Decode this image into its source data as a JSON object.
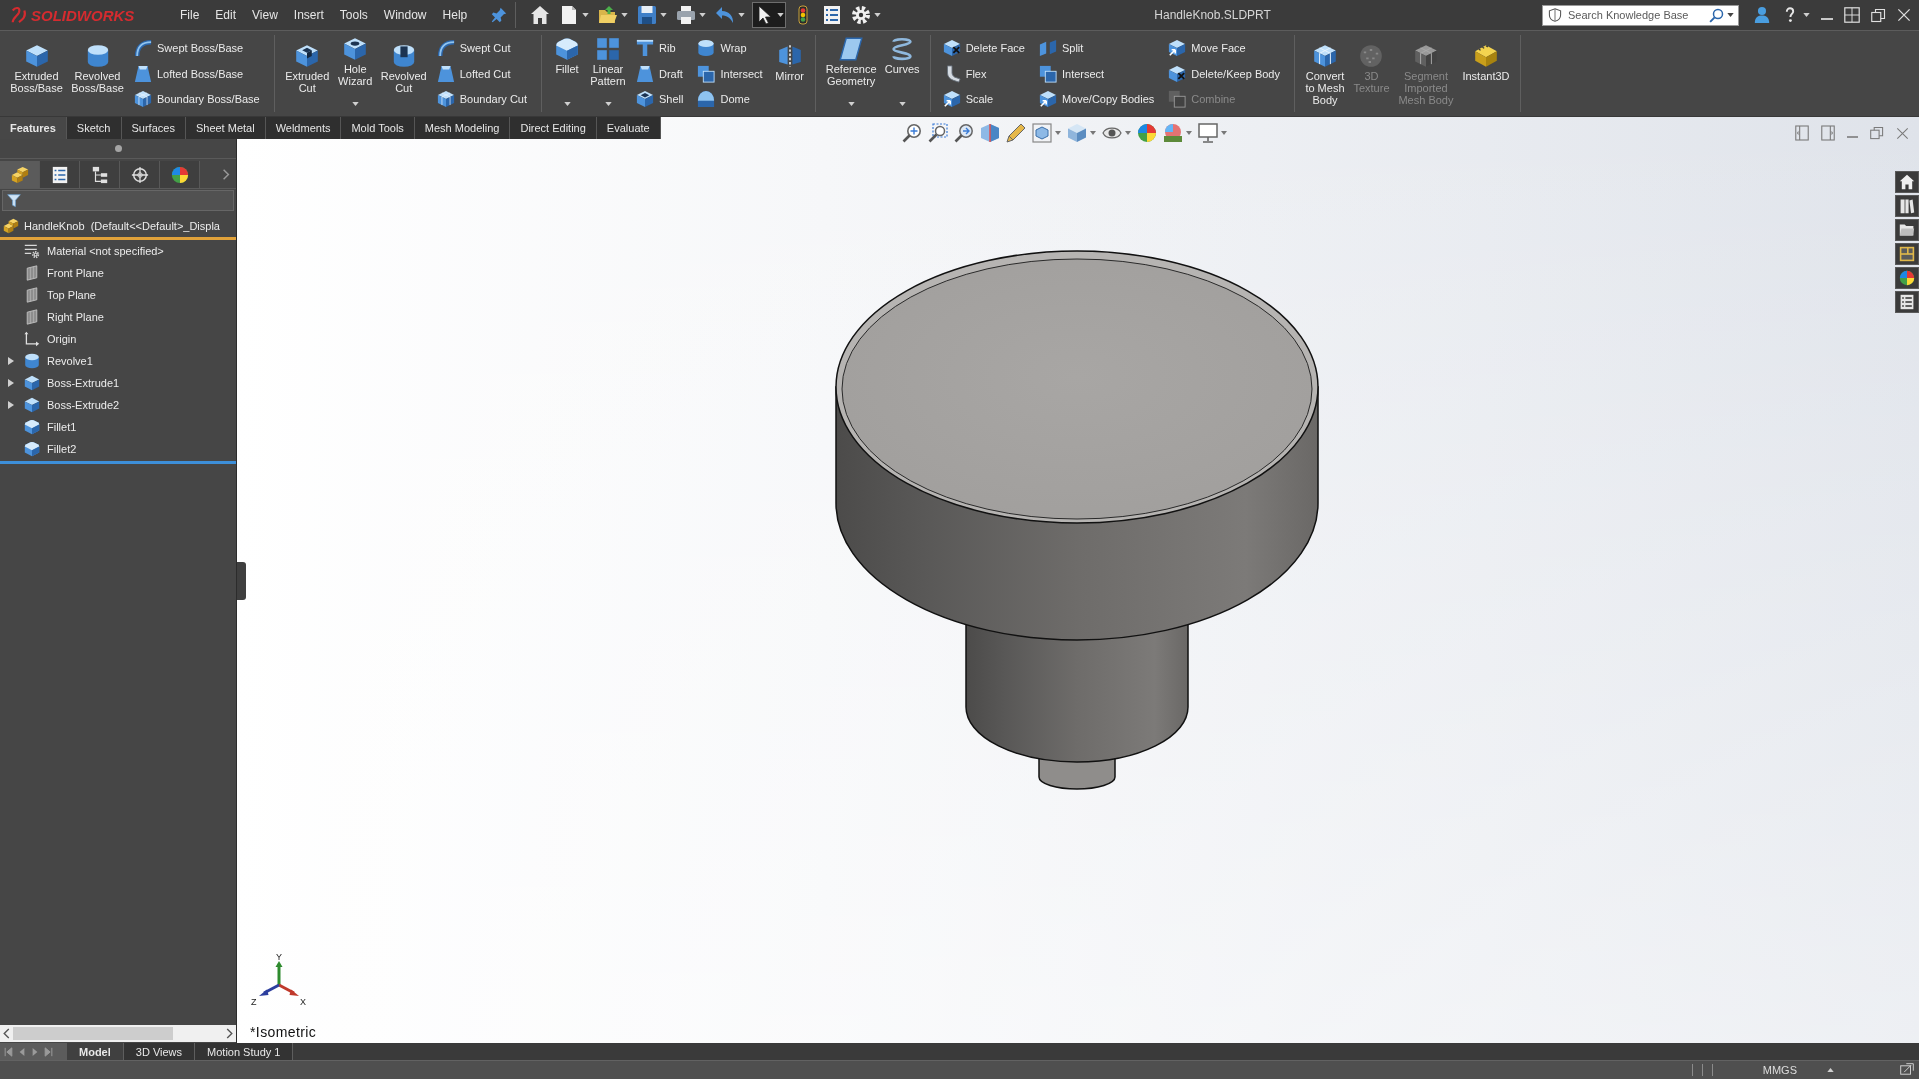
{
  "title_bar": {
    "logo": "SOLIDWORKS",
    "menu": [
      "File",
      "Edit",
      "View",
      "Insert",
      "Tools",
      "Window",
      "Help"
    ],
    "quick_access": [
      {
        "kind": "home",
        "dropdown": false,
        "selected": false
      },
      {
        "kind": "new",
        "dropdown": true,
        "selected": false
      },
      {
        "kind": "open",
        "dropdown": true,
        "selected": false
      },
      {
        "kind": "save",
        "dropdown": true,
        "selected": false
      },
      {
        "kind": "print",
        "dropdown": true,
        "selected": false
      },
      {
        "kind": "undo",
        "dropdown": true,
        "selected": false
      },
      {
        "kind": "select",
        "dropdown": true,
        "selected": true
      },
      {
        "kind": "rebuild",
        "dropdown": false,
        "selected": false
      },
      {
        "kind": "properties",
        "dropdown": false,
        "selected": false
      },
      {
        "kind": "options",
        "dropdown": true,
        "selected": false
      }
    ],
    "document_title": "HandleKnob.SLDPRT",
    "search": {
      "placeholder": "Search Knowledge Base"
    }
  },
  "ribbon": {
    "groups": [
      {
        "items": [
          {
            "kind": "extrude",
            "label": "Extruded Boss/Base",
            "dropdown": false,
            "disabled": false
          },
          {
            "kind": "revolve",
            "label": "Revolved Boss/Base",
            "dropdown": false,
            "disabled": false
          },
          {
            "stack": [
              {
                "kind": "sweep",
                "label": "Swept Boss/Base",
                "disabled": false
              },
              {
                "kind": "loft",
                "label": "Lofted Boss/Base",
                "disabled": false
              },
              {
                "kind": "boundary",
                "label": "Boundary Boss/Base",
                "disabled": false
              }
            ]
          }
        ]
      },
      {
        "items": [
          {
            "kind": "cutextrude",
            "label": "Extruded Cut",
            "dropdown": false,
            "disabled": false
          },
          {
            "kind": "hole",
            "label": "Hole Wizard",
            "dropdown": true,
            "disabled": false
          },
          {
            "kind": "cutrevolve",
            "label": "Revolved Cut",
            "dropdown": false,
            "disabled": false
          },
          {
            "stack": [
              {
                "kind": "cutsweep",
                "label": "Swept Cut",
                "disabled": false
              },
              {
                "kind": "cutloft",
                "label": "Lofted Cut",
                "disabled": false
              },
              {
                "kind": "cutboundary",
                "label": "Boundary Cut",
                "disabled": false
              }
            ]
          }
        ]
      },
      {
        "items": [
          {
            "kind": "fillet",
            "label": "Fillet",
            "dropdown": true,
            "disabled": false
          },
          {
            "kind": "pattern",
            "label": "Linear Pattern",
            "dropdown": true,
            "disabled": false
          },
          {
            "stack": [
              {
                "kind": "rib",
                "label": "Rib",
                "disabled": false
              },
              {
                "kind": "draft",
                "label": "Draft",
                "disabled": false
              },
              {
                "kind": "shell",
                "label": "Shell",
                "disabled": false
              }
            ]
          },
          {
            "stack": [
              {
                "kind": "wrap",
                "label": "Wrap",
                "disabled": false
              },
              {
                "kind": "intersect",
                "label": "Intersect",
                "disabled": false
              },
              {
                "kind": "dome",
                "label": "Dome",
                "disabled": false
              }
            ]
          },
          {
            "kind": "mirror",
            "label": "Mirror",
            "dropdown": false,
            "disabled": false
          }
        ]
      },
      {
        "items": [
          {
            "kind": "reference",
            "label": "Reference Geometry",
            "dropdown": true,
            "disabled": false
          },
          {
            "kind": "curves",
            "label": "Curves",
            "dropdown": true,
            "disabled": false
          }
        ]
      },
      {
        "items": [
          {
            "stack": [
              {
                "kind": "deleteface",
                "label": "Delete Face",
                "disabled": false
              },
              {
                "kind": "flex",
                "label": "Flex",
                "disabled": false
              },
              {
                "kind": "scale",
                "label": "Scale",
                "disabled": false
              }
            ]
          },
          {
            "stack": [
              {
                "kind": "split",
                "label": "Split",
                "disabled": false
              },
              {
                "kind": "intersect",
                "label": "Intersect",
                "disabled": false
              },
              {
                "kind": "movecopy",
                "label": "Move/Copy Bodies",
                "disabled": false
              }
            ]
          },
          {
            "stack": [
              {
                "kind": "moveface",
                "label": "Move Face",
                "disabled": false
              },
              {
                "kind": "deletebody",
                "label": "Delete/Keep Body",
                "disabled": false
              },
              {
                "kind": "combine",
                "label": "Combine",
                "disabled": true
              }
            ]
          }
        ]
      },
      {
        "items": [
          {
            "kind": "meshconvert",
            "label": "Convert to Mesh Body",
            "dropdown": false,
            "disabled": false
          },
          {
            "kind": "texture",
            "label": "3D Texture",
            "dropdown": false,
            "disabled": true
          },
          {
            "kind": "segment",
            "label": "Segment Imported Mesh Body",
            "dropdown": false,
            "disabled": true
          },
          {
            "kind": "instant3d",
            "label": "Instant3D",
            "dropdown": false,
            "disabled": false
          }
        ]
      }
    ]
  },
  "command_tabs": [
    {
      "label": "Features",
      "selected": true
    },
    {
      "label": "Sketch",
      "selected": false
    },
    {
      "label": "Surfaces",
      "selected": false
    },
    {
      "label": "Sheet Metal",
      "selected": false
    },
    {
      "label": "Weldments",
      "selected": false
    },
    {
      "label": "Mold Tools",
      "selected": false
    },
    {
      "label": "Mesh Modeling",
      "selected": false
    },
    {
      "label": "Direct Editing",
      "selected": false
    },
    {
      "label": "Evaluate",
      "selected": false
    }
  ],
  "manager_tabs": [
    {
      "kind": "features",
      "selected": true
    },
    {
      "kind": "properties",
      "selected": false
    },
    {
      "kind": "configurations",
      "selected": false
    },
    {
      "kind": "dimxpert",
      "selected": false
    },
    {
      "kind": "display",
      "selected": false
    }
  ],
  "feature_tree": {
    "label": "HandleKnob  (Default<<Default>_Displa",
    "kind": "part",
    "children": [
      {
        "label": "Material <not specified>",
        "kind": "material"
      },
      {
        "label": "Front Plane",
        "kind": "plane"
      },
      {
        "label": "Top Plane",
        "kind": "plane"
      },
      {
        "label": "Right Plane",
        "kind": "plane"
      },
      {
        "label": "Origin",
        "kind": "origin"
      },
      {
        "label": "Revolve1",
        "kind": "revolve",
        "expanded": false
      },
      {
        "label": "Boss-Extrude1",
        "kind": "extrude",
        "expanded": false
      },
      {
        "label": "Boss-Extrude2",
        "kind": "extrude",
        "expanded": false
      },
      {
        "label": "Fillet1",
        "kind": "fillet"
      },
      {
        "label": "Fillet2",
        "kind": "fillet"
      }
    ]
  },
  "viewport": {
    "view_toolbar": [
      {
        "kind": "fit",
        "dropdown": false
      },
      {
        "kind": "area",
        "dropdown": false
      },
      {
        "kind": "previous",
        "dropdown": false
      },
      {
        "kind": "section",
        "dropdown": false
      },
      {
        "kind": "annotations",
        "dropdown": false
      },
      {
        "kind": "orientation",
        "dropdown": true
      },
      {
        "kind": "style",
        "dropdown": true
      },
      {
        "kind": "visibility",
        "dropdown": true
      },
      {
        "kind": "appearance",
        "dropdown": false
      },
      {
        "kind": "scene",
        "dropdown": true
      },
      {
        "kind": "settings",
        "dropdown": true
      }
    ],
    "triad": {
      "x": "X",
      "y": "Y",
      "z": "Z"
    },
    "view_name": "*Isometric"
  },
  "model_tabs": [
    {
      "label": "Model",
      "selected": true
    },
    {
      "label": "3D Views",
      "selected": false
    },
    {
      "label": "Motion Study 1",
      "selected": false
    }
  ],
  "status_bar": {
    "units": "MMGS"
  }
}
